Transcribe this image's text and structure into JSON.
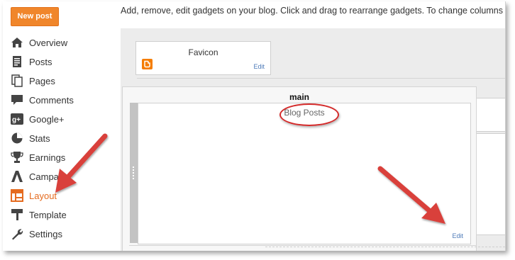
{
  "header": {
    "instruction": "Add, remove, edit gadgets on your blog. Click and drag to rearrange gadgets. To change columns an"
  },
  "sidebar": {
    "new_post_label": "New post",
    "items": [
      {
        "label": "Overview",
        "icon": "home-icon"
      },
      {
        "label": "Posts",
        "icon": "posts-icon"
      },
      {
        "label": "Pages",
        "icon": "pages-icon"
      },
      {
        "label": "Comments",
        "icon": "comments-icon"
      },
      {
        "label": "Google+",
        "icon": "google-plus-icon"
      },
      {
        "label": "Stats",
        "icon": "stats-icon"
      },
      {
        "label": "Earnings",
        "icon": "trophy-icon"
      },
      {
        "label": "Campai",
        "icon": "campaigns-icon"
      },
      {
        "label": "Layout",
        "icon": "layout-icon",
        "active": true
      },
      {
        "label": "Template",
        "icon": "template-icon"
      },
      {
        "label": "Settings",
        "icon": "wrench-icon"
      }
    ]
  },
  "layout": {
    "favicon_gadget": {
      "title": "Favicon",
      "edit_label": "Edit"
    },
    "main_section": {
      "label": "main",
      "blog_posts_gadget": {
        "title": "Blog Posts",
        "edit_label": "Edit"
      }
    }
  },
  "colors": {
    "accent": "#e56b1f",
    "new_post_bg": "#f0862b",
    "annotation_red": "#d42a2a",
    "link_blue": "#4d7ab8"
  }
}
